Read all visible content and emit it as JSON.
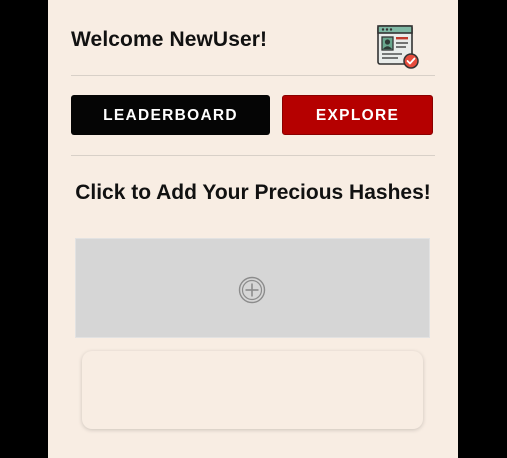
{
  "header": {
    "welcome_text": "Welcome NewUser!",
    "profile_icon": "id-card-verified-icon"
  },
  "nav": {
    "leaderboard_label": "LEADERBOARD",
    "explore_label": "EXPLORE"
  },
  "main": {
    "title": "Click to Add Your Precious Hashes!",
    "add_icon": "plus-circle-icon"
  },
  "colors": {
    "background": "#f8ede3",
    "leaderboard_button": "#050505",
    "explore_button": "#b50000",
    "add_area": "#d6d6d6"
  }
}
